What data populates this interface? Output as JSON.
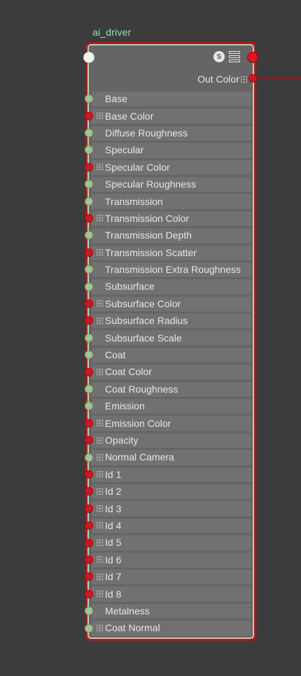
{
  "node": {
    "title": "ai_driver",
    "output_label": "Out Color",
    "header_icons": [
      "swatch-icon",
      "list-icon"
    ]
  },
  "colors": {
    "background": "#3c3c3c",
    "node_body": "#656565",
    "row": "#717171",
    "frame_selected": "#b0161d",
    "border_inner": "#a9d8b6",
    "title_text": "#8fe3b5",
    "port_color_type": "#d8141a",
    "port_float_type": "#a4c292"
  },
  "attributes": [
    {
      "label": "Base",
      "port": "green",
      "expand": false
    },
    {
      "label": "Base Color",
      "port": "red",
      "expand": true
    },
    {
      "label": "Diffuse Roughness",
      "port": "green",
      "expand": false
    },
    {
      "label": "Specular",
      "port": "green",
      "expand": false
    },
    {
      "label": "Specular Color",
      "port": "red",
      "expand": true
    },
    {
      "label": "Specular Roughness",
      "port": "green",
      "expand": false
    },
    {
      "label": "Transmission",
      "port": "green",
      "expand": false
    },
    {
      "label": "Transmission Color",
      "port": "red",
      "expand": true
    },
    {
      "label": "Transmission Depth",
      "port": "green",
      "expand": false
    },
    {
      "label": "Transmission Scatter",
      "port": "red",
      "expand": true
    },
    {
      "label": "Transmission Extra Roughness",
      "port": "green",
      "expand": false
    },
    {
      "label": "Subsurface",
      "port": "green",
      "expand": false
    },
    {
      "label": "Subsurface Color",
      "port": "red",
      "expand": true
    },
    {
      "label": "Subsurface Radius",
      "port": "red",
      "expand": true
    },
    {
      "label": "Subsurface Scale",
      "port": "green",
      "expand": false
    },
    {
      "label": "Coat",
      "port": "green",
      "expand": false
    },
    {
      "label": "Coat Color",
      "port": "red",
      "expand": true
    },
    {
      "label": "Coat Roughness",
      "port": "green",
      "expand": false
    },
    {
      "label": "Emission",
      "port": "green",
      "expand": false
    },
    {
      "label": "Emission Color",
      "port": "red",
      "expand": true
    },
    {
      "label": "Opacity",
      "port": "red",
      "expand": true
    },
    {
      "label": "Normal Camera",
      "port": "green",
      "expand": true
    },
    {
      "label": "Id 1",
      "port": "red",
      "expand": true
    },
    {
      "label": "Id 2",
      "port": "red",
      "expand": true
    },
    {
      "label": "Id 3",
      "port": "red",
      "expand": true
    },
    {
      "label": "Id 4",
      "port": "red",
      "expand": true
    },
    {
      "label": "Id 5",
      "port": "red",
      "expand": true
    },
    {
      "label": "Id 6",
      "port": "red",
      "expand": true
    },
    {
      "label": "Id 7",
      "port": "red",
      "expand": true
    },
    {
      "label": "Id 8",
      "port": "red",
      "expand": true
    },
    {
      "label": "Metalness",
      "port": "green",
      "expand": false
    },
    {
      "label": "Coat Normal",
      "port": "green",
      "expand": true
    }
  ]
}
